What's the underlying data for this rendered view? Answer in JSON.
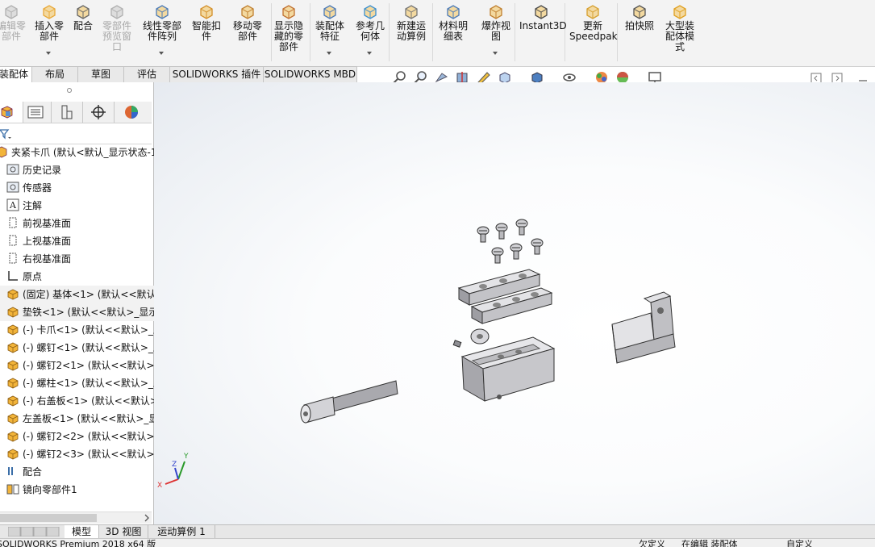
{
  "ribbon": {
    "buttons": [
      {
        "label": "编辑零\n部件",
        "icon": "edit-component-icon",
        "disabled": true
      },
      {
        "label": "插入零\n部件",
        "icon": "insert-component-icon",
        "disabled": false
      },
      {
        "label": "配合",
        "icon": "mate-icon",
        "disabled": false
      },
      {
        "label": "零部件\n预览窗\n口",
        "icon": "component-preview-icon",
        "disabled": true
      },
      {
        "label": "线性零部\n件阵列",
        "icon": "linear-pattern-icon",
        "disabled": false
      },
      {
        "label": "智能扣\n件",
        "icon": "smart-fasteners-icon",
        "disabled": false
      },
      {
        "label": "移动零\n部件",
        "icon": "move-component-icon",
        "disabled": false
      },
      {
        "label": "显示隐\n藏的零\n部件",
        "icon": "show-hidden-icon",
        "disabled": false
      },
      {
        "label": "装配体\n特征",
        "icon": "assembly-features-icon",
        "disabled": false
      },
      {
        "label": "参考几\n何体",
        "icon": "reference-geometry-icon",
        "disabled": false
      },
      {
        "label": "新建运\n动算例",
        "icon": "motion-study-icon",
        "disabled": false
      },
      {
        "label": "材料明\n细表",
        "icon": "bom-icon",
        "disabled": false
      },
      {
        "label": "爆炸视\n图",
        "icon": "exploded-view-icon",
        "disabled": false
      },
      {
        "label": "Instant3D",
        "icon": "instant3d-icon",
        "disabled": false
      },
      {
        "label": "更新\nSpeedpak",
        "icon": "speedpak-icon",
        "disabled": false
      },
      {
        "label": "拍快照",
        "icon": "snapshot-icon",
        "disabled": false
      },
      {
        "label": "大型装\n配体模\n式",
        "icon": "large-assembly-icon",
        "disabled": false
      }
    ]
  },
  "tabs": [
    "装配体",
    "布局",
    "草图",
    "评估",
    "SOLIDWORKS 插件",
    "SOLIDWORKS MBD"
  ],
  "panel": {
    "root_label": "夹紧卡爪  (默认<默认_显示状态-1",
    "items": [
      {
        "label": "历史记录",
        "icon": "history-icon"
      },
      {
        "label": "传感器",
        "icon": "sensor-icon"
      },
      {
        "label": "注解",
        "icon": "annotation-icon"
      },
      {
        "label": "前视基准面",
        "icon": "plane-icon"
      },
      {
        "label": "上视基准面",
        "icon": "plane-icon"
      },
      {
        "label": "右视基准面",
        "icon": "plane-icon"
      },
      {
        "label": "原点",
        "icon": "origin-icon"
      },
      {
        "label": "(固定) 基体<1> (默认<<默认",
        "icon": "part-icon"
      },
      {
        "label": "垫铁<1> (默认<<默认>_显示",
        "icon": "part-icon"
      },
      {
        "label": "(-) 卡爪<1> (默认<<默认>_显",
        "icon": "part-icon"
      },
      {
        "label": "(-) 螺钉<1> (默认<<默认>_显",
        "icon": "part-icon"
      },
      {
        "label": "(-) 螺钉2<1> (默认<<默认>_显",
        "icon": "part-icon"
      },
      {
        "label": "(-) 螺柱<1> (默认<<默认>_显",
        "icon": "part-icon"
      },
      {
        "label": "(-) 右盖板<1> (默认<<默认>_",
        "icon": "part-icon"
      },
      {
        "label": "左盖板<1> (默认<<默认>_显示",
        "icon": "part-icon"
      },
      {
        "label": "(-) 螺钉2<2> (默认<<默认>_显",
        "icon": "part-icon"
      },
      {
        "label": "(-) 螺钉2<3> (默认<<默认>_显",
        "icon": "part-icon"
      },
      {
        "label": "配合",
        "icon": "mates-folder-icon"
      },
      {
        "label": "镜向零部件1",
        "icon": "mirror-component-icon"
      }
    ]
  },
  "bottom_tabs": [
    "模型",
    "3D 视图",
    "运动算例 1"
  ],
  "status": {
    "left": "SOLIDWORKS Premium 2018 x64 版",
    "mid1": "欠定义",
    "mid2": "在编辑 装配体",
    "right": "自定义"
  },
  "triad": {
    "x": "X",
    "y": "Y",
    "z": "Z"
  }
}
